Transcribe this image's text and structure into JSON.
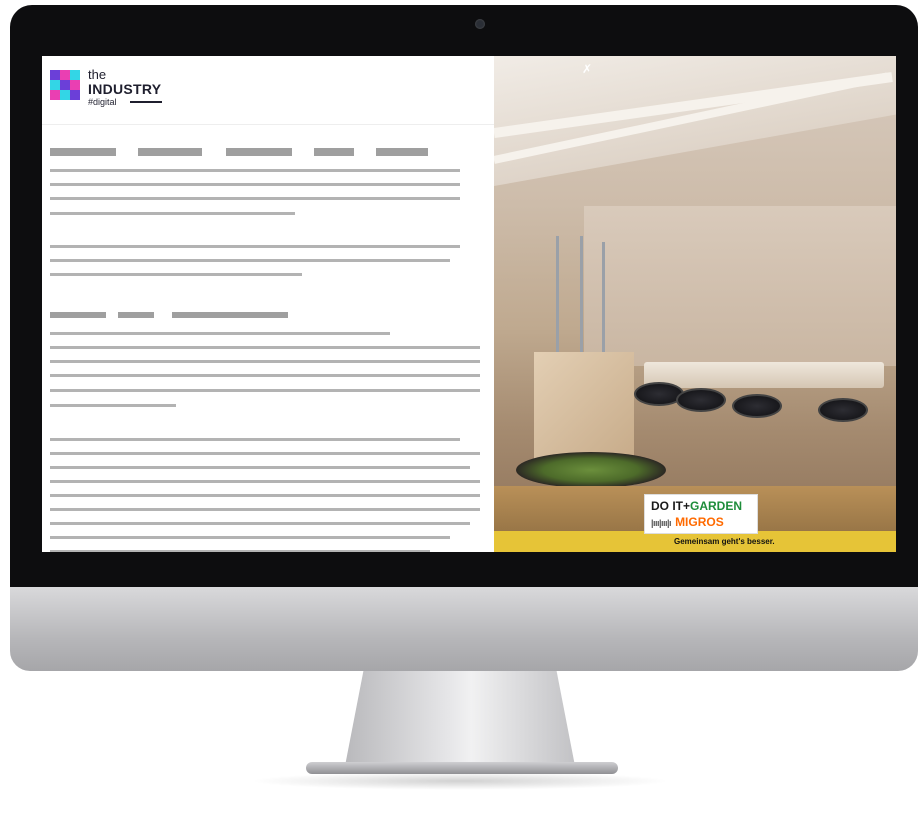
{
  "brand": {
    "logo_the": "the",
    "logo_industry": "INDUSTRY",
    "logo_digital": "#digital",
    "colors": {
      "magenta": "#ea3fb2",
      "cyan": "#33d6e6",
      "purple": "#6b3fd8",
      "dark": "#1f1f2e"
    }
  },
  "article": {
    "placeholder_color": "#b3b3b3",
    "note": ""
  },
  "video": {
    "mute_icon": "muted-speaker-icon",
    "ad": {
      "line1_part1": "DO IT",
      "line1_plus": "+",
      "line1_part2": "GARDEN",
      "ruler_glyph": "|ııı|ııı|ı",
      "line2": "MIGROS",
      "slogan": "Gemeinsam geht's besser.",
      "colors": {
        "garden": "#1e8d3a",
        "migros": "#ff6a00",
        "band": "#e6c437"
      }
    }
  }
}
